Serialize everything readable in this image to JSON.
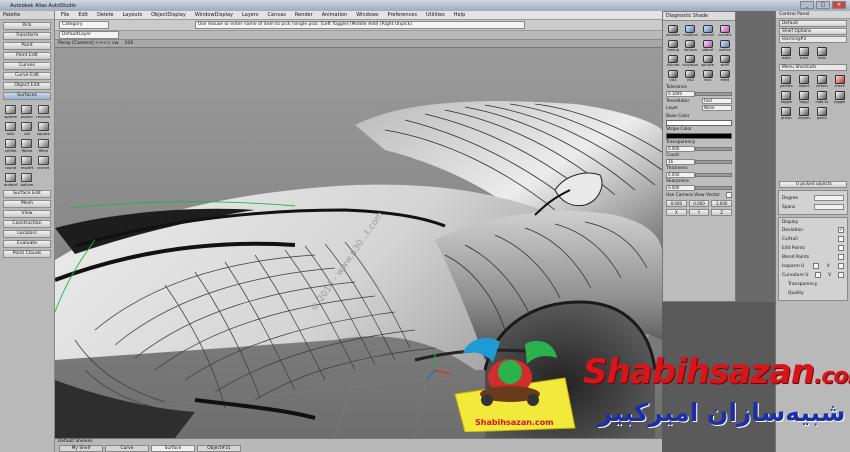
{
  "window": {
    "title": "Autodesk Alias AutoStudio",
    "buttons": [
      "_",
      "□",
      "×"
    ]
  },
  "menu": [
    "File",
    "Edit",
    "Delete",
    "Layouts",
    "ObjectDisplay",
    "WindowDisplay",
    "Layers",
    "Canvas",
    "Render",
    "Animation",
    "Windows",
    "Preferences",
    "Utilities",
    "Help"
  ],
  "toolbar": {
    "category": "Category",
    "layer": "DefaultLayer",
    "prompt": "Use mouse or enter name of item to pick [single pick: [Left Toggle] [Middle Add] [Right Unpick]"
  },
  "viewport": {
    "title": "Persp [Camera] <<<< vw",
    "zoom": "100"
  },
  "palette": {
    "title": "Palette",
    "top_buttons": [
      "Pick",
      "Transform",
      "Paint",
      "Paint Edit",
      "Curves",
      "Curve Edit",
      "Object Edit",
      "Surfaces"
    ],
    "tools": [
      "sphere",
      "planar",
      "revolve",
      "skin",
      "rail",
      "square",
      "srfillet",
      "ffblnd",
      "ffillet",
      "round",
      "msdrft",
      "crvnet",
      "dmberf",
      "ballom"
    ],
    "bottom_buttons": [
      "Surface Edit",
      "Mesh",
      "View",
      "Construction",
      "Locators",
      "Evaluate",
      "Point Clouds"
    ]
  },
  "diag": {
    "title": "Diagnostic Shade",
    "tools": [
      "shdrom",
      "multicol",
      "isoncol",
      "curvanl",
      "isoang",
      "horizon",
      "zebraf",
      "usetex",
      "fluirnet",
      "clayasun",
      "sphlsfe",
      "wrefl",
      "vis1",
      "vis2",
      "vis3",
      "filled"
    ],
    "tolerance": {
      "label": "Tolerance",
      "value": "0.1000"
    },
    "tessellator": {
      "label": "Tessellator",
      "value": "Fast"
    },
    "layer": {
      "label": "Layer",
      "value": "None"
    },
    "base_color": "Base Color",
    "stripe_color": "Stripe Color",
    "transparency": {
      "label": "Transparency",
      "value": "0.000"
    },
    "count": {
      "label": "Count",
      "value": "16"
    },
    "thickness": {
      "label": "Thickness",
      "value": "0.050"
    },
    "sharpness": {
      "label": "Sharpness",
      "value": "0.000"
    },
    "camera_vector": "Use Camera View Vector",
    "vector": [
      "0.000",
      "0.000",
      "1.000"
    ],
    "axes": [
      "X",
      "Y",
      "Z"
    ]
  },
  "control": {
    "title": "Control Panel",
    "dropdown1": "Default",
    "dropdown2": "Shelf Options",
    "tab": "learning#2",
    "shelf_tools": [
      "exits",
      "tutrs",
      "help"
    ],
    "menu_shortcuts": "Menu Shortcuts",
    "shortcut_tools": [
      "palette",
      "object",
      "inform",
      "check",
      "toggle",
      "toggl",
      "hide-ar",
      "toggle",
      "group",
      "ungrou",
      "query"
    ],
    "picked": "0 picked objects",
    "degree": "Degree",
    "spans": "Spans",
    "display": {
      "title": "Display",
      "items": [
        {
          "label": "Deviation",
          "checked": true
        },
        {
          "label": "Cv/Hull",
          "checked": false
        },
        {
          "label": "Edit Points",
          "checked": false
        },
        {
          "label": "Blend Points",
          "checked": false
        },
        {
          "label": "Isoparm U",
          "checked": false
        },
        {
          "label": "Curvature U",
          "checked": false
        }
      ],
      "v_label": "V",
      "sub": [
        "Transparency",
        "Quality"
      ]
    }
  },
  "shelves": {
    "title": "Default Shelves",
    "tabs": [
      "My Shelf",
      "Curve",
      "Surface",
      "Object#31"
    ],
    "active": "Surface"
  },
  "viewport_text": {
    "watermark_small": "© 2016 - www.p30...t.com",
    "lock": "LOCK"
  },
  "watermark": {
    "en": "Shabihsazan",
    "en_suffix": ".com",
    "fa": "شبیه‌سازان امیرکبیر",
    "logo_text": "Shabihsazan.com"
  },
  "colors": {
    "accent": "#d8151b",
    "fa_text": "#1c2fa8",
    "logo_bg": "#f2ea3a"
  }
}
